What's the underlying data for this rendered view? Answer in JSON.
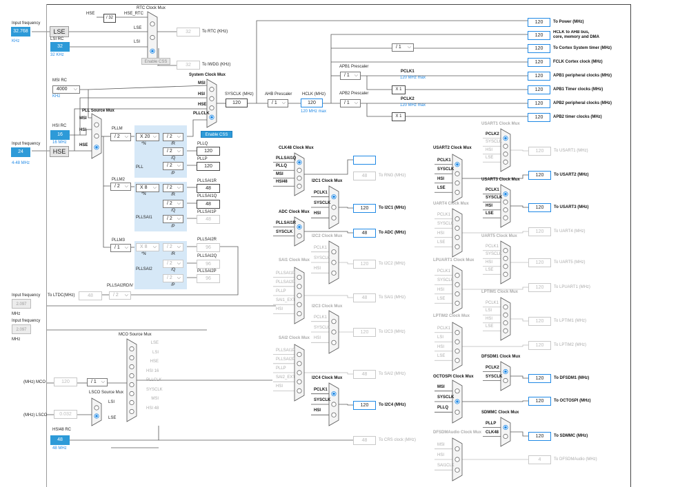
{
  "inputs": {
    "lse_freq_label": "Input frequency",
    "lse_freq_value": "32.768",
    "lse_unit": "KHz",
    "lse_label": "LSE",
    "lsi_rc_label": "LSI RC",
    "lsi_value": "32",
    "lsi_unit": "32 KHz",
    "msi_rc_label": "MSI RC",
    "msi_value": "4000",
    "msi_unit": "KHz",
    "hsi_rc_label": "HSI RC",
    "hsi_value": "16",
    "hsi_unit": "16 MHz",
    "hse_freq_label": "Input frequency",
    "hse_freq_value": "24",
    "hse_range": "4-48 MHz",
    "hse_label": "HSE",
    "ext1_label": "Input frequency",
    "ext1_value": "2.097",
    "ext1_unit": "MHz",
    "ext2_label": "Input frequency",
    "ext2_value": "2.097",
    "ext2_unit": "MHz",
    "hsi48_rc_label": "HSI48 RC",
    "hsi48_value": "48",
    "hsi48_unit": "48 MHz"
  },
  "rtc": {
    "title": "RTC Clock Mux",
    "hse_label": "HSE",
    "div32": "/ 32",
    "hse_rtc": "HSE_RTC",
    "lse": "LSE",
    "lsi": "LSI",
    "rtc_out": "32",
    "rtc_out_label": "To RTC (KHz)",
    "iwdg_out": "32",
    "iwdg_out_label": "To IWDG (KHz)",
    "enable_css": "Enable CSS"
  },
  "sysclk": {
    "title": "System Clock Mux",
    "msi": "MSI",
    "hsi": "HSI",
    "hse": "HSE",
    "pllclk": "PLLCLK",
    "enable_css": "Enable CSS",
    "sysclk_label": "SYSCLK (MHz)",
    "sysclk_value": "120",
    "ahb_label": "AHB Prescaler",
    "ahb_value": "/ 1",
    "hclk_label": "HCLK (MHz)",
    "hclk_value": "120",
    "hclk_max": "120 MHz max",
    "apb1_label": "APB1 Prescaler",
    "apb1_value": "/ 1",
    "apb2_label": "APB2 Prescaler",
    "apb2_value": "/ 1",
    "systick_div": "/ 1",
    "pclk1": "PCLK1",
    "pclk1_max": "120 MHz max",
    "pclk2": "PCLK2",
    "pclk2_max": "120 MHz max",
    "x1a": "X 1",
    "x1b": "X 1"
  },
  "outputs": [
    {
      "value": "120",
      "label": "To Power (MHz)"
    },
    {
      "value": "120",
      "label": "HCLK to AHB bus, core, memory and DMA (MHz)"
    },
    {
      "value": "120",
      "label": "To Cortex System timer (MHz)"
    },
    {
      "value": "120",
      "label": "FCLK Cortex clock (MHz)"
    },
    {
      "value": "120",
      "label": "APB1 peripheral clocks (MHz)"
    },
    {
      "value": "120",
      "label": "APB1 Timer clocks (MHz)"
    },
    {
      "value": "120",
      "label": "APB2 peripheral clocks (MHz)"
    },
    {
      "value": "120",
      "label": "APB2 timer clocks (MHz)"
    }
  ],
  "pll": {
    "src_title": "PLL Source Mux",
    "src_msi": "MSI",
    "src_hsi": "HSI",
    "src_hse": "HSE",
    "pllm_label": "PLLM",
    "pllm_value": "/ 2",
    "mult": "X 20",
    "n": "*N",
    "r_div": "/ 2",
    "r": "/R",
    "q_div": "/ 2",
    "q": "/Q",
    "p_div": "/ 2",
    "p": "/P",
    "name": "PLL",
    "pllq_label": "PLLQ",
    "pllq_value": "120",
    "pllp_label": "PLLP",
    "pllp_value": "120"
  },
  "pllsai1": {
    "m_label": "PLLM2",
    "m_value": "/ 2",
    "mult": "X 8",
    "n": "*N",
    "r_div": "/ 2",
    "r": "/R",
    "q_div": "/ 2",
    "q": "/Q",
    "p_div": "/ 2",
    "p": "/P",
    "name": "PLLSAI1",
    "r_label": "PLLSAI1R",
    "r_value": "48",
    "q_label": "PLLSAI1Q",
    "q_value": "48",
    "p_label": "PLLSAI1P",
    "p_value": "48"
  },
  "pllsai2": {
    "m_label": "PLLM3",
    "m_value": "/ 1",
    "mult": "X 8",
    "n": "*N",
    "r_div": "/ 2",
    "r": "/R",
    "q_div": "/ 2",
    "q": "/Q",
    "p_div": "/ 2",
    "p": "/P",
    "name": "PLLSAI2",
    "r_label": "PLLSAI2R",
    "r_value": "96",
    "q_label": "PLLSAI2Q",
    "q_value": "96",
    "p_label": "PLLSAI2P",
    "p_value": "96",
    "rdiv_label": "PLLSAI2RDIV",
    "rdiv_value": "/ 2",
    "ltdc_label": "To LTDC(MHz)",
    "ltdc_value": "48"
  },
  "mco": {
    "title": "MCO Source Mux",
    "items": [
      "LSE",
      "LSI",
      "HSE",
      "HSI 16",
      "PLLCLK",
      "SYSCLK",
      "MSI",
      "HSI 48"
    ],
    "out_label": "(MHz) MCO",
    "out_value": "120",
    "div": "/ 1",
    "lsco_title": "LSCO Source Mux",
    "lsco_lsi": "LSI",
    "lsco_lse": "LSE",
    "lsco_label": "(MHz) LSCO",
    "lsco_value": "0.032"
  },
  "clk48": {
    "title": "CLK48 Clock Mux",
    "in": [
      "PLLSAI1Q",
      "PLLQ",
      "MSI",
      "HSI48"
    ],
    "usb_value": "48",
    "usb_label": "To USB (MHz)",
    "rng_value": "48",
    "rng_label": "To RNG (MHz)"
  },
  "adc": {
    "title": "ADC Clock Mux",
    "in": [
      "PLLSAI1R",
      "SYSCLK"
    ],
    "value": "48",
    "label": "To ADC (MHz)"
  },
  "sai1": {
    "title": "SAI1 Clock Mux",
    "in": [
      "PLLSAI1P",
      "PLLSAI2P",
      "PLLP",
      "SAI1_EXT",
      "HSI"
    ],
    "value": "48",
    "label": "To SAI1 (MHz)"
  },
  "sai2": {
    "title": "SAI2 Clock Mux",
    "in": [
      "PLLSAI1P",
      "PLLSAI2P",
      "PLLP",
      "SAI2_EXT",
      "HSI"
    ],
    "value": "48",
    "label": "To SAI2 (MHz)"
  },
  "crs": {
    "value": "48",
    "label": "To CRS clock (MHz)"
  },
  "i2c1": {
    "title": "I2C1 Clock Mux",
    "in": [
      "PCLK1",
      "SYSCLK",
      "HSI"
    ],
    "value": "120",
    "label": "To I2C1 (MHz)"
  },
  "i2c2": {
    "title": "I2C2 Clock Mux",
    "in": [
      "PCLK1",
      "SYSCLK",
      "HSI"
    ],
    "value": "120",
    "label": "To I2C2 (MHz)"
  },
  "i2c3": {
    "title": "I2C3 Clock Mux",
    "in": [
      "PCLK1",
      "SYSCLK",
      "HSI"
    ],
    "value": "120",
    "label": "To I2C3 (MHz)"
  },
  "i2c4": {
    "title": "I2C4 Clock Mux",
    "in": [
      "PCLK1",
      "SYSCLK",
      "HSI"
    ],
    "value": "120",
    "label": "To I2C4 (MHz)"
  },
  "usart2": {
    "title": "USART2 Clock Mux",
    "in": [
      "PCLK1",
      "SYSCLK",
      "HSI",
      "LSE"
    ],
    "value": "120",
    "label": "To USART2 (MHz)"
  },
  "uart4": {
    "title": "UART4 Clock Mux",
    "in": [
      "PCLK1",
      "SYSCLK",
      "HSI",
      "LSE"
    ],
    "value": "120",
    "label": "To UART4 (MHz)"
  },
  "lpuart1": {
    "title": "LPUART1 Clock Mux",
    "in": [
      "PCLK1",
      "SYSCLK",
      "HSI",
      "LSE"
    ],
    "value": "120",
    "label": "To LPUART1 (MHz)"
  },
  "lptim2": {
    "title": "LPTIM2 Clock Mux",
    "in": [
      "PCLK1",
      "LSI",
      "HSI",
      "LSE"
    ],
    "value": "120",
    "label": "To LPTIM2 (MHz)"
  },
  "octospi": {
    "title": "OCTOSPI Clock Mux",
    "in": [
      "MSI",
      "SYSCLK",
      "PLLQ"
    ],
    "value": "120",
    "label": "To OCTOSPI (MHz)"
  },
  "dfsdmaudio": {
    "title": "DFSDMAudio Clock Mux",
    "in": [
      "MSI",
      "HSI",
      "SAI1CLK"
    ],
    "value": "4",
    "label": "To DFSDMAudio (MHz)"
  },
  "usart1": {
    "title": "USART1 Clock Mux",
    "in": [
      "PCLK2",
      "SYSCLK",
      "HSI",
      "LSE"
    ],
    "value": "120",
    "label": "To USART1 (MHz)"
  },
  "usart3": {
    "title": "USART3 Clock Mux",
    "in": [
      "PCLK1",
      "SYSCLK",
      "HSI",
      "LSE"
    ],
    "value": "120",
    "label": "To USART3 (MHz)"
  },
  "uart5": {
    "title": "UART5 Clock Mux",
    "in": [
      "PCLK1",
      "SYSCLK",
      "HSI",
      "LSE"
    ],
    "value": "120",
    "label": "To UART5 (MHz)"
  },
  "lptim1": {
    "title": "LPTIM1 Clock Mux",
    "in": [
      "PCLK1",
      "LSI",
      "HSI",
      "LSE"
    ],
    "value": "120",
    "label": "To LPTIM1 (MHz)"
  },
  "dfsdm1": {
    "title": "DFSDM1 Clock Mux",
    "in": [
      "PCLK2",
      "SYSCLK"
    ],
    "value": "120",
    "label": "To DFSDM1 (MHz)"
  },
  "sdmmc": {
    "title": "SDMMC Clock Mux",
    "in": [
      "PLLP",
      "CLK48"
    ],
    "value": "120",
    "label": "To SDMMC (MHz)"
  },
  "unlabeled_out": {
    "value": "120",
    "label": "To LPTIM2 (MHz)"
  }
}
